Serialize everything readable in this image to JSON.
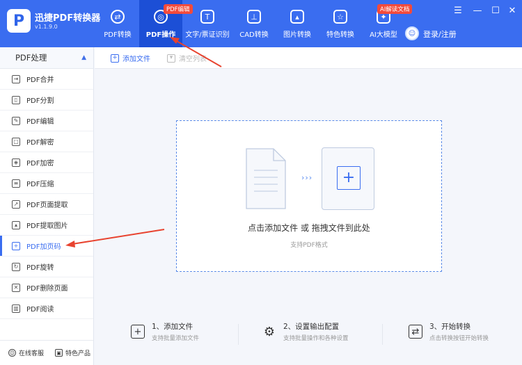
{
  "app": {
    "title": "迅捷PDF转换器",
    "version": "v1.1.9.0",
    "logo_letter": "P"
  },
  "nav": [
    {
      "label": "PDF转换",
      "icon": "refresh-circle-icon",
      "glyph": "⇄"
    },
    {
      "label": "PDF操作",
      "icon": "settings-circle-icon",
      "glyph": "◎",
      "badge": "PDF编辑"
    },
    {
      "label": "文字/票证识别",
      "icon": "scan-frame-icon",
      "glyph": "T"
    },
    {
      "label": "CAD转换",
      "icon": "cad-icon",
      "glyph": "⊥"
    },
    {
      "label": "图片转换",
      "icon": "image-icon",
      "glyph": "▴"
    },
    {
      "label": "特色转换",
      "icon": "star-box-icon",
      "glyph": "☆"
    },
    {
      "label": "AI大模型",
      "icon": "ai-star-icon",
      "glyph": "✦",
      "badge": "AI解读文档"
    }
  ],
  "header": {
    "login": "登录/注册",
    "min": "—",
    "max": "☐",
    "close": "✕",
    "menu": "☰"
  },
  "sidebar": {
    "title": "PDF处理",
    "items": [
      {
        "label": "PDF合并",
        "glyph": "⇥"
      },
      {
        "label": "PDF分割",
        "glyph": "▯"
      },
      {
        "label": "PDF编辑",
        "glyph": "✎"
      },
      {
        "label": "PDF解密",
        "glyph": "▢"
      },
      {
        "label": "PDF加密",
        "glyph": "◈"
      },
      {
        "label": "PDF压缩",
        "glyph": "≡"
      },
      {
        "label": "PDF页面提取",
        "glyph": "↗"
      },
      {
        "label": "PDF提取图片",
        "glyph": "▴"
      },
      {
        "label": "PDF加页码",
        "glyph": "+"
      },
      {
        "label": "PDF旋转",
        "glyph": "↻"
      },
      {
        "label": "PDF删除页面",
        "glyph": "✕"
      },
      {
        "label": "PDF阅读",
        "glyph": "▥"
      }
    ],
    "footer": {
      "service": "在线客服",
      "features": "特色产品"
    }
  },
  "toolbar": {
    "add": "添加文件",
    "clear": "清空列表"
  },
  "dropzone": {
    "main": "点击添加文件 或 拖拽文件到此处",
    "sub": "支持PDF格式",
    "arrows": "›››"
  },
  "steps": [
    {
      "title": "1、添加文件",
      "desc": "支持批量添加文件",
      "icon": "add-file-icon"
    },
    {
      "title": "2、设置输出配置",
      "desc": "支持批量操作和各种设置",
      "icon": "gear-icon"
    },
    {
      "title": "3、开始转换",
      "desc": "点击转换按钮开始转换",
      "icon": "convert-icon"
    }
  ],
  "colors": {
    "primary": "#3a6df0",
    "active_nav": "#1c4fd6",
    "badge": "#f34a3b",
    "annotation": "#e8432f"
  }
}
